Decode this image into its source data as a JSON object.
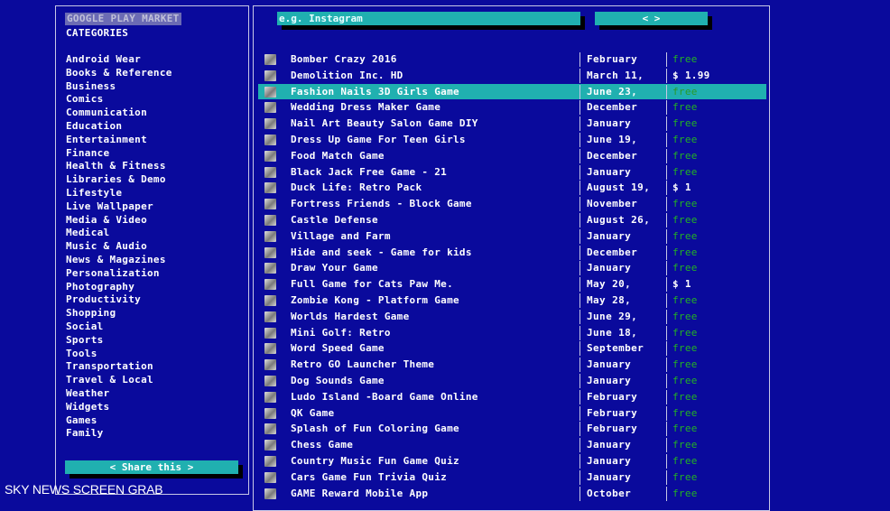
{
  "sidebar": {
    "market_title": "GOOGLE PLAY MARKET",
    "categories_title": "CATEGORIES",
    "categories": [
      "Android Wear",
      "Books & Reference",
      "Business",
      "Comics",
      "Communication",
      "Education",
      "Entertainment",
      "Finance",
      "Health & Fitness",
      "Libraries & Demo",
      "Lifestyle",
      "Live Wallpaper",
      "Media & Video",
      "Medical",
      "Music & Audio",
      "News & Magazines",
      "Personalization",
      "Photography",
      "Productivity",
      "Shopping",
      "Social",
      "Sports",
      "Tools",
      "Transportation",
      "Travel & Local",
      "Weather",
      "Widgets",
      "Games",
      "Family"
    ],
    "share_label": "< Share this >"
  },
  "search": {
    "placeholder": "e.g. Instagram",
    "value": ""
  },
  "pager": {
    "label": "< >"
  },
  "apps": [
    {
      "name": "Bomber Crazy 2016",
      "date": "February",
      "price": "free"
    },
    {
      "name": "Demolition Inc. HD",
      "date": "March 11,",
      "price": "$ 1.99"
    },
    {
      "name": "Fashion Nails 3D Girls Game",
      "date": "June 23,",
      "price": "free",
      "selected": true
    },
    {
      "name": "Wedding Dress Maker Game",
      "date": "December",
      "price": "free"
    },
    {
      "name": "Nail Art Beauty Salon Game DIY",
      "date": "January",
      "price": "free"
    },
    {
      "name": "Dress Up Game For Teen Girls",
      "date": "June 19,",
      "price": "free"
    },
    {
      "name": "Food Match Game",
      "date": "December",
      "price": "free"
    },
    {
      "name": "Black Jack Free Game - 21",
      "date": "January",
      "price": "free"
    },
    {
      "name": "Duck Life: Retro Pack",
      "date": "August 19,",
      "price": "$ 1"
    },
    {
      "name": "Fortress Friends - Block Game",
      "date": "November",
      "price": "free"
    },
    {
      "name": "Castle Defense",
      "date": "August 26,",
      "price": "free"
    },
    {
      "name": "Village and Farm",
      "date": "January",
      "price": "free"
    },
    {
      "name": "Hide and seek - Game for kids",
      "date": "December",
      "price": "free"
    },
    {
      "name": "Draw Your Game",
      "date": "January",
      "price": "free"
    },
    {
      "name": "Full Game for Cats Paw Me.",
      "date": "May 20,",
      "price": "$ 1"
    },
    {
      "name": "Zombie Kong - Platform Game",
      "date": "May 28,",
      "price": "free"
    },
    {
      "name": "Worlds Hardest Game",
      "date": "June 29,",
      "price": "free"
    },
    {
      "name": "Mini Golf: Retro",
      "date": "June 18,",
      "price": "free"
    },
    {
      "name": "Word Speed Game",
      "date": "September",
      "price": "free"
    },
    {
      "name": "Retro GO Launcher Theme",
      "date": "January",
      "price": "free"
    },
    {
      "name": "Dog Sounds Game",
      "date": "January",
      "price": "free"
    },
    {
      "name": "Ludo Island -Board Game Online",
      "date": "February",
      "price": "free"
    },
    {
      "name": "QK Game",
      "date": "February",
      "price": "free"
    },
    {
      "name": "Splash of Fun Coloring Game",
      "date": "February",
      "price": "free"
    },
    {
      "name": "Chess Game",
      "date": "January",
      "price": "free"
    },
    {
      "name": "Country Music Fun Game Quiz",
      "date": "January",
      "price": "free"
    },
    {
      "name": "Cars Game Fun Trivia Quiz",
      "date": "January",
      "price": "free"
    },
    {
      "name": "GAME Reward Mobile App",
      "date": "October",
      "price": "free"
    }
  ],
  "watermark": "SKY NEWS SCREEN GRAB",
  "colors": {
    "background": "#0a0a9c",
    "accent": "#20b0b0",
    "free_price": "#23b423",
    "text": "#ffffff"
  }
}
